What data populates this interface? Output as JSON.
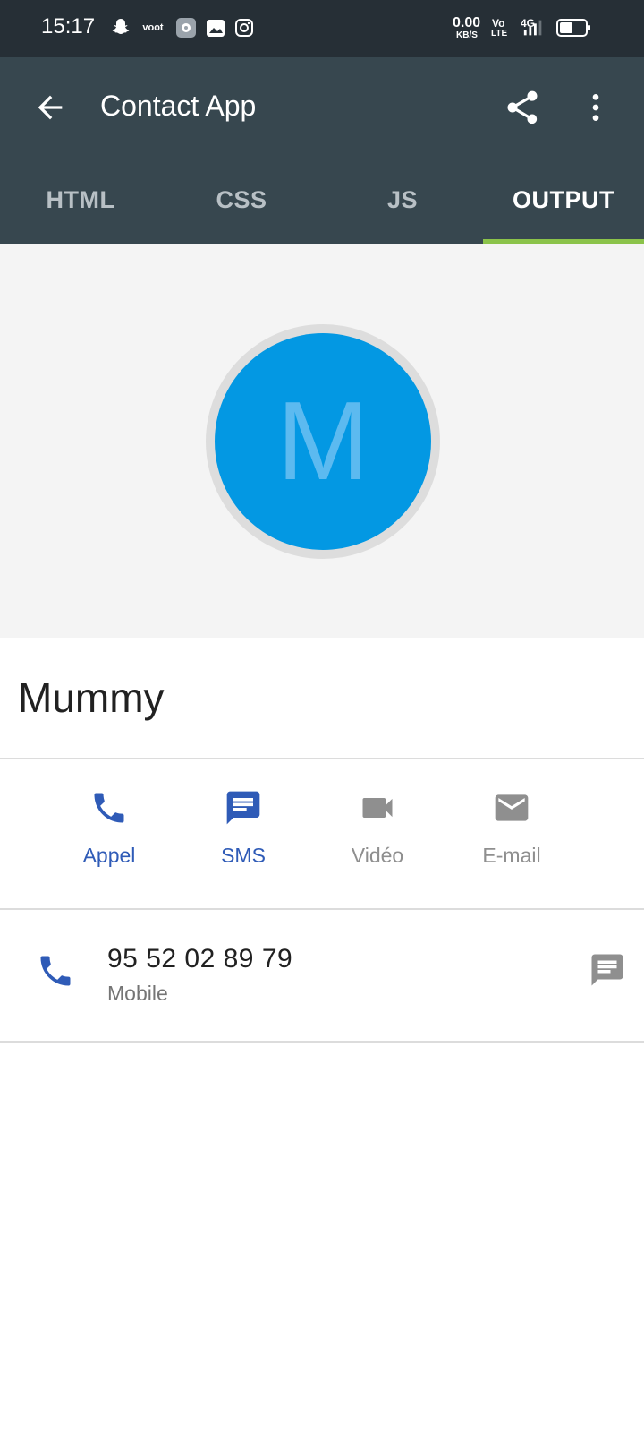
{
  "status_bar": {
    "time": "15:17",
    "net_speed_value": "0.00",
    "net_speed_unit": "KB/S",
    "volte_top": "Vo",
    "volte_bottom": "LTE",
    "network": "4G",
    "icons": [
      "snapchat-icon",
      "voot-icon",
      "settings-app-icon",
      "gallery-icon",
      "instagram-icon",
      "signal-icon",
      "battery-icon"
    ],
    "voot_label": "voot"
  },
  "app_bar": {
    "title": "Contact App",
    "back_icon": "arrow-left-icon",
    "share_icon": "share-icon",
    "menu_icon": "more-vert-icon"
  },
  "tabs": [
    {
      "label": "HTML",
      "active": false
    },
    {
      "label": "CSS",
      "active": false
    },
    {
      "label": "JS",
      "active": false
    },
    {
      "label": "OUTPUT",
      "active": true
    }
  ],
  "contact": {
    "initial": "M",
    "name": "Mummy"
  },
  "actions": [
    {
      "label": "Appel",
      "icon": "phone-icon",
      "enabled": true
    },
    {
      "label": "SMS",
      "icon": "sms-icon",
      "enabled": true
    },
    {
      "label": "Vidéo",
      "icon": "videocam-icon",
      "enabled": false
    },
    {
      "label": "E-mail",
      "icon": "email-icon",
      "enabled": false
    }
  ],
  "phone": {
    "number": "95 52 02 89 79",
    "type": "Mobile"
  },
  "colors": {
    "status_bar": "#262f36",
    "app_bar": "#37474f",
    "tab_indicator": "#8bc34a",
    "avatar": "#0398e3",
    "action_blue": "#2f5bb7",
    "action_grey": "#8f8f8f"
  }
}
